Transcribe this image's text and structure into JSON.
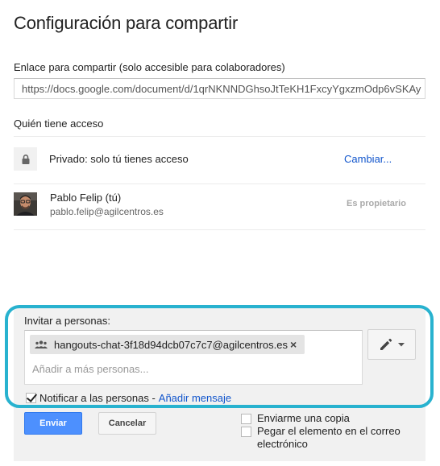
{
  "dialog": {
    "title": "Configuración para compartir"
  },
  "share_link": {
    "label": "Enlace para compartir (solo accesible para colaboradores)",
    "value": "https://docs.google.com/document/d/1qrNKNNDGhsoJtTeKH1FxcyYgxzmOdp6vSKAy"
  },
  "access": {
    "label": "Quién tiene acceso",
    "visibility": {
      "icon": "lock-icon",
      "text": "Privado: solo tú tienes acceso",
      "change_label": "Cambiar..."
    },
    "owner": {
      "name": "Pablo Felip (tú)",
      "email": "pablo.felip@agilcentros.es",
      "role": "Es propietario"
    }
  },
  "invite": {
    "label": "Invitar a personas:",
    "chip": {
      "icon": "group-icon",
      "text": "hangouts-chat-3f18d94dcb07c7c7@agilcentros.es",
      "remove_symbol": "×"
    },
    "placeholder": "Añadir a más personas...",
    "permission_icon": "pencil-icon",
    "notify": {
      "checked": true,
      "label": "Notificar a las personas -",
      "add_message_label": "Añadir mensaje"
    }
  },
  "actions": {
    "send_label": "Enviar",
    "cancel_label": "Cancelar"
  },
  "options": [
    {
      "label": "Enviarme una copia",
      "checked": false
    },
    {
      "label": "Pegar el elemento en el correo electrónico",
      "checked": false
    }
  ],
  "colors": {
    "accent_link": "#1155cc",
    "send_button": "#4d90fe",
    "highlight_ring": "#28b2cf"
  }
}
